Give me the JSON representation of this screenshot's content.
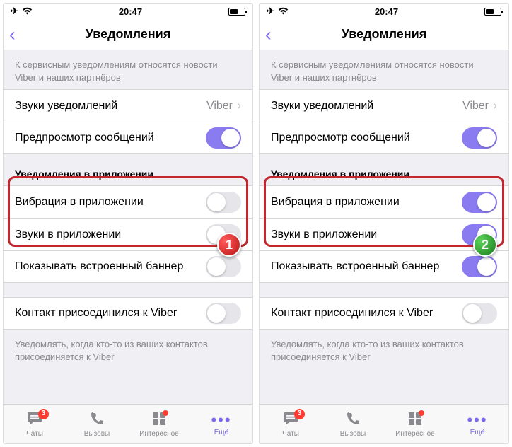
{
  "screens": [
    {
      "status": {
        "time": "20:47"
      },
      "nav": {
        "title": "Уведомления"
      },
      "note_top": "К сервисным уведомлениям относятся новости Viber и наших партнёров",
      "sound_row": {
        "label": "Звуки уведомлений",
        "value": "Viber"
      },
      "preview_row": {
        "label": "Предпросмотр сообщений",
        "on": true
      },
      "section_inapp": "Уведомления в приложении",
      "vibration_row": {
        "label": "Вибрация в приложении",
        "on": false
      },
      "sounds_inapp_row": {
        "label": "Звуки в приложении",
        "on": false
      },
      "banner_row": {
        "label": "Показывать встроенный баннер",
        "on": false
      },
      "contact_row": {
        "label": "Контакт присоединился к Viber",
        "on": false
      },
      "note_bottom": "Уведомлять, когда кто-то из ваших контактов присоединяется к Viber",
      "step_badge": "1",
      "tabs": {
        "chats": {
          "label": "Чаты",
          "badge": "3"
        },
        "calls": {
          "label": "Вызовы"
        },
        "interesting": {
          "label": "Интересное"
        },
        "more": {
          "label": "Ещё"
        }
      }
    },
    {
      "status": {
        "time": "20:47"
      },
      "nav": {
        "title": "Уведомления"
      },
      "note_top": "К сервисным уведомлениям относятся новости Viber и наших партнёров",
      "sound_row": {
        "label": "Звуки уведомлений",
        "value": "Viber"
      },
      "preview_row": {
        "label": "Предпросмотр сообщений",
        "on": true
      },
      "section_inapp": "Уведомления в приложении",
      "vibration_row": {
        "label": "Вибрация в приложении",
        "on": true
      },
      "sounds_inapp_row": {
        "label": "Звуки в приложении",
        "on": true
      },
      "banner_row": {
        "label": "Показывать встроенный баннер",
        "on": true
      },
      "contact_row": {
        "label": "Контакт присоединился к Viber",
        "on": false
      },
      "note_bottom": "Уведомлять, когда кто-то из ваших контактов присоединяется к Viber",
      "step_badge": "2",
      "tabs": {
        "chats": {
          "label": "Чаты",
          "badge": "3"
        },
        "calls": {
          "label": "Вызовы"
        },
        "interesting": {
          "label": "Интересное"
        },
        "more": {
          "label": "Ещё"
        }
      }
    }
  ]
}
